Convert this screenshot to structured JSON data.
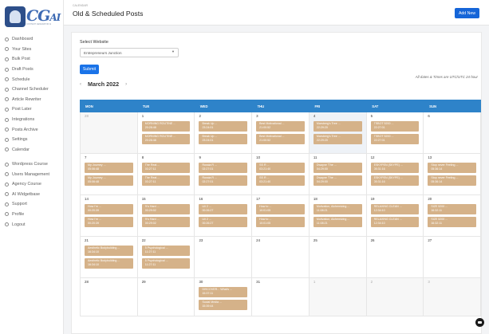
{
  "app": {
    "logo_text": "CG",
    "logo_accent": "AI",
    "logo_subtitle": "CONTENT GENERATOR AI"
  },
  "sidebar": {
    "items": [
      {
        "label": "Dashboard",
        "icon": "home-icon"
      },
      {
        "label": "Your Sites",
        "icon": "globe-icon"
      },
      {
        "label": "Bulk Post",
        "icon": "layers-icon"
      },
      {
        "label": "Draft Posts",
        "icon": "file-icon"
      },
      {
        "label": "Schedule",
        "icon": "clock-icon"
      },
      {
        "label": "Channel Scheduler",
        "icon": "calendar-icon"
      },
      {
        "label": "Article Rewriter",
        "icon": "edit-icon"
      },
      {
        "label": "Post Later",
        "icon": "send-icon"
      },
      {
        "label": "Integrations",
        "icon": "plug-icon"
      },
      {
        "label": "Posts Archive",
        "icon": "archive-icon"
      },
      {
        "label": "Settings",
        "icon": "gear-icon"
      },
      {
        "label": "Calendar",
        "icon": "calendar-icon"
      },
      {
        "label": "Wordpress Course",
        "icon": "book-icon"
      },
      {
        "label": "Users Management",
        "icon": "users-icon"
      },
      {
        "label": "Agency Course",
        "icon": "graduation-icon"
      },
      {
        "label": "AI Widgetbase",
        "icon": "widget-icon"
      },
      {
        "label": "Support",
        "icon": "help-icon"
      },
      {
        "label": "Profile",
        "icon": "user-icon"
      },
      {
        "label": "Logout",
        "icon": "logout-icon"
      }
    ]
  },
  "header": {
    "breadcrumb": "CALENDAR",
    "title": "Old & Scheduled Posts",
    "add_button": "Add New"
  },
  "form": {
    "select_label": "Select Website",
    "selected_site": "Entrepreneurs Junction",
    "submit": "Submit"
  },
  "calendar": {
    "month": "March 2022",
    "prev_icon": "chevron-left-icon",
    "next_icon": "chevron-right-icon",
    "timezone_note": "All dates & Times are UTC/UTC 24 hour",
    "weekdays": [
      "MON",
      "TUE",
      "WED",
      "THU",
      "FRI",
      "SAT",
      "SUN"
    ],
    "weeks": [
      [
        {
          "num": "28",
          "muted": true,
          "events": []
        },
        {
          "num": "1",
          "events": [
            {
              "title": "MORNING ROUTINE ...",
              "time": "20:28:48"
            },
            {
              "title": "MORNING ROUTINE ...",
              "time": "20:28:48"
            }
          ]
        },
        {
          "num": "2",
          "events": [
            {
              "title": "Break Up ...",
              "time": "23:24:01"
            },
            {
              "title": "Break Up ...",
              "time": "23:24:01"
            }
          ]
        },
        {
          "num": "3",
          "events": [
            {
              "title": "Best Motivational ...",
              "time": "21:00:52"
            },
            {
              "title": "Best Motivational ...",
              "time": "21:00:52"
            }
          ]
        },
        {
          "num": "4",
          "today": true,
          "events": [
            {
              "title": "Marsberg's Tree ...",
              "time": "22:29:20"
            },
            {
              "title": "Marsberg's Tree ...",
              "time": "22:29:20"
            }
          ]
        },
        {
          "num": "5",
          "events": [
            {
              "title": "TSBOT 5200 ...",
              "time": "22:27:01"
            },
            {
              "title": "TSBOT 5200 ...",
              "time": "22:27:01"
            }
          ]
        },
        {
          "num": "6",
          "events": []
        }
      ],
      [
        {
          "num": "7",
          "events": [
            {
              "title": "My Journey ...",
              "time": "05:06:48"
            },
            {
              "title": "My Journey ...",
              "time": "05:06:48"
            }
          ]
        },
        {
          "num": "8",
          "events": [
            {
              "title": "The Real ...",
              "time": "03:27:11"
            },
            {
              "title": "The Real ...",
              "time": "03:27:11"
            }
          ]
        },
        {
          "num": "9",
          "events": [
            {
              "title": "Russia R ...",
              "time": "02:27:01"
            },
            {
              "title": "Russia R ...",
              "time": "02:27:01"
            }
          ]
        },
        {
          "num": "10",
          "events": [
            {
              "title": "SS R ...",
              "time": "03:21:40"
            },
            {
              "title": "SS R ...",
              "time": "03:21:40"
            }
          ]
        },
        {
          "num": "11",
          "events": [
            {
              "title": "Dwayne 'The ...",
              "time": "04:29:00"
            },
            {
              "title": "Dwayne 'The ...",
              "time": "04:29:00"
            }
          ]
        },
        {
          "num": "12",
          "events": [
            {
              "title": "ESKYPEN (SKYPE) ...",
              "time": "05:31:16"
            },
            {
              "title": "ESKYPEN (SKYPE) ...",
              "time": "05:31:16"
            }
          ]
        },
        {
          "num": "13",
          "events": [
            {
              "title": "Stop never Feeling ...",
              "time": "05:36:14"
            },
            {
              "title": "Stop never Feeling ...",
              "time": "05:36:14"
            }
          ]
        }
      ],
      [
        {
          "num": "14",
          "events": [
            {
              "title": "How I'm ...",
              "time": "00:20:39"
            },
            {
              "title": "How I'm ...",
              "time": "00:20:39"
            }
          ]
        },
        {
          "num": "15",
          "events": [
            {
              "title": "'It's Hard ...",
              "time": "00:29:02"
            },
            {
              "title": "'It's Hard ...",
              "time": "00:29:02"
            }
          ]
        },
        {
          "num": "16",
          "events": [
            {
              "title": "Lili 2 ...",
              "time": "00:26:27"
            },
            {
              "title": "Lili 2 ...",
              "time": "00:26:27"
            }
          ]
        },
        {
          "num": "17",
          "events": [
            {
              "title": "How to ...",
              "time": "10:01:05"
            },
            {
              "title": "How to ...",
              "time": "10:01:05"
            }
          ]
        },
        {
          "num": "18",
          "events": [
            {
              "title": "Motivation, Alchemizing ...",
              "time": "11:08:21"
            },
            {
              "title": "Motivation, Alchemizing ...",
              "time": "11:08:21"
            }
          ]
        },
        {
          "num": "19",
          "events": [
            {
              "title": "RELAXING CLEAN ...",
              "time": "12:34:10"
            },
            {
              "title": "RELAXING CLEAN ...",
              "time": "12:34:10"
            }
          ]
        },
        {
          "num": "20",
          "events": [
            {
              "title": "SIZE 5200 ...",
              "time": "16:32:11"
            },
            {
              "title": "SIZE 5200 ...",
              "time": "16:32:11"
            }
          ]
        }
      ],
      [
        {
          "num": "21",
          "events": [
            {
              "title": "Aesthetic Bodybuilding ...",
              "time": "16:34:10"
            },
            {
              "title": "Aesthetic Bodybuilding ...",
              "time": "16:34:10"
            }
          ]
        },
        {
          "num": "22",
          "events": [
            {
              "title": "5 Psychological ...",
              "time": "11:27:11"
            },
            {
              "title": "5 Psychological ...",
              "time": "11:27:11"
            }
          ]
        },
        {
          "num": "23",
          "events": []
        },
        {
          "num": "24",
          "events": []
        },
        {
          "num": "25",
          "events": []
        },
        {
          "num": "26",
          "events": []
        },
        {
          "num": "27",
          "events": []
        }
      ],
      [
        {
          "num": "28",
          "events": []
        },
        {
          "num": "29",
          "events": []
        },
        {
          "num": "30",
          "events": [
            {
              "title": "DISCOVER... What's ...",
              "time": "15:37:11"
            },
            {
              "title": "Social Media ...",
              "time": "15:39:44"
            }
          ]
        },
        {
          "num": "31",
          "events": []
        },
        {
          "num": "1",
          "muted": true,
          "events": []
        },
        {
          "num": "2",
          "muted": true,
          "events": []
        },
        {
          "num": "3",
          "muted": true,
          "events": []
        }
      ]
    ]
  },
  "colors": {
    "accent": "#1a73e8",
    "header_bar": "#2e83c9",
    "event": "#d5b289"
  }
}
